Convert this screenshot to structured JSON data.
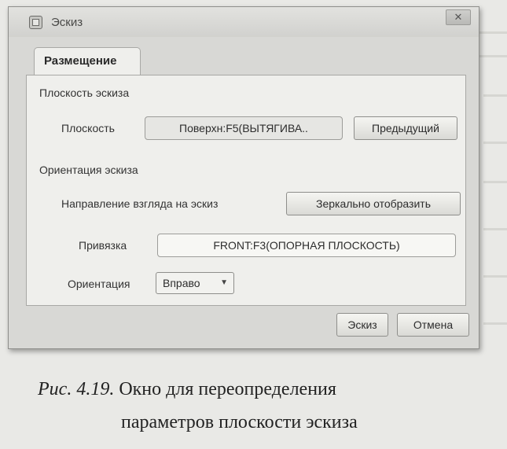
{
  "window": {
    "title": "Эскиз",
    "close_glyph": "✕"
  },
  "tabs": [
    {
      "label": "Размещение",
      "active": true
    }
  ],
  "sketch_plane": {
    "section_label": "Плоскость эскиза",
    "plane_label": "Плоскость",
    "plane_value": "Поверхн:F5(ВЫТЯГИВА..",
    "previous_button": "Предыдущий"
  },
  "sketch_orientation": {
    "section_label": "Ориентация эскиза",
    "view_direction_label": "Направление взгляда на эскиз",
    "flip_button": "Зеркально отобразить",
    "reference_label": "Привязка",
    "reference_value": "FRONT:F3(ОПОРНАЯ ПЛОСКОСТЬ)",
    "orientation_label": "Ориентация",
    "orientation_value": "Вправо",
    "orientation_icon": "chevron-down-icon"
  },
  "footer": {
    "ok_button": "Эскиз",
    "cancel_button": "Отмена"
  },
  "caption": {
    "figure_label": "Рис. 4.19.",
    "line1": "Окно для переопределения",
    "line2": "параметров плоскости эскиза"
  }
}
